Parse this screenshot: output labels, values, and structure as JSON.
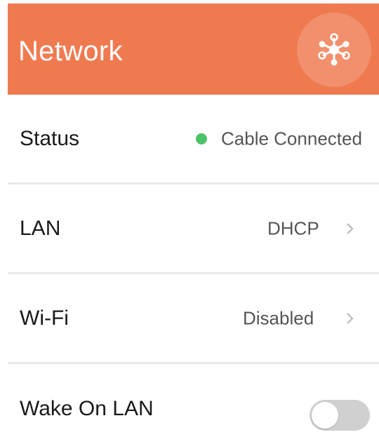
{
  "header": {
    "title": "Network",
    "action_icon": "network-nodes-icon",
    "color": "#F07A50"
  },
  "rows": {
    "status": {
      "label": "Status",
      "value": "Cable Connected",
      "indicator_color": "#4CC26A"
    },
    "lan": {
      "label": "LAN",
      "value": "DHCP",
      "icon": "chevron-right-icon"
    },
    "wifi": {
      "label": "Wi-Fi",
      "value": "Disabled",
      "icon": "chevron-right-icon"
    },
    "wake_on_lan": {
      "label": "Wake On LAN",
      "enabled": false
    }
  }
}
